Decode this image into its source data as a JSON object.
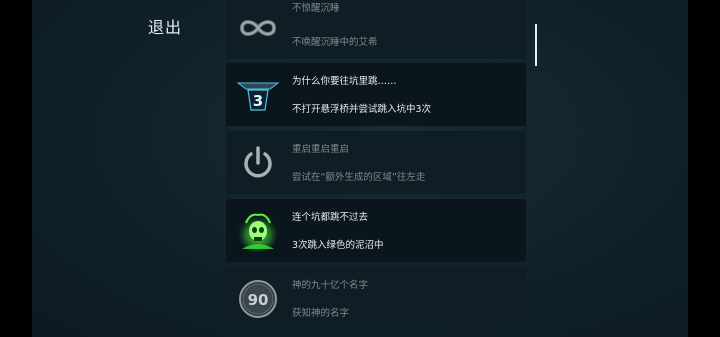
{
  "header": {
    "exit_label": "退出"
  },
  "achievements": [
    {
      "title": "不惊醒沉睡",
      "desc": "不唤醒沉睡中的艾希",
      "icon": "infinity-icon",
      "state": "locked"
    },
    {
      "title": "为什么你要往坑里跳……",
      "desc": "不打开悬浮桥并尝试跳入坑中3次",
      "icon": "pit-three-icon",
      "icon_text": "3",
      "state": "unlocked"
    },
    {
      "title": "重启重启重启",
      "desc": "尝试在“额外生成的区域”往左走",
      "icon": "power-icon",
      "state": "locked"
    },
    {
      "title": "连个坑都跳不过去",
      "desc": "3次跳入绿色的泥沼中",
      "icon": "green-skull-icon",
      "state": "unlocked"
    },
    {
      "title": "神的九十亿个名字",
      "desc": "获知神的名字",
      "icon": "ninety-badge-icon",
      "icon_text": "90",
      "state": "locked"
    }
  ],
  "colors": {
    "panel_bg": "#11232c",
    "row_unlocked_bg": "#0b161c",
    "row_locked_bg": "#0f1d24",
    "text_unlocked": "#e6ecef",
    "text_locked": "#7c8a91",
    "accent_blue": "#4cc3e8",
    "accent_green": "#39e23a"
  }
}
